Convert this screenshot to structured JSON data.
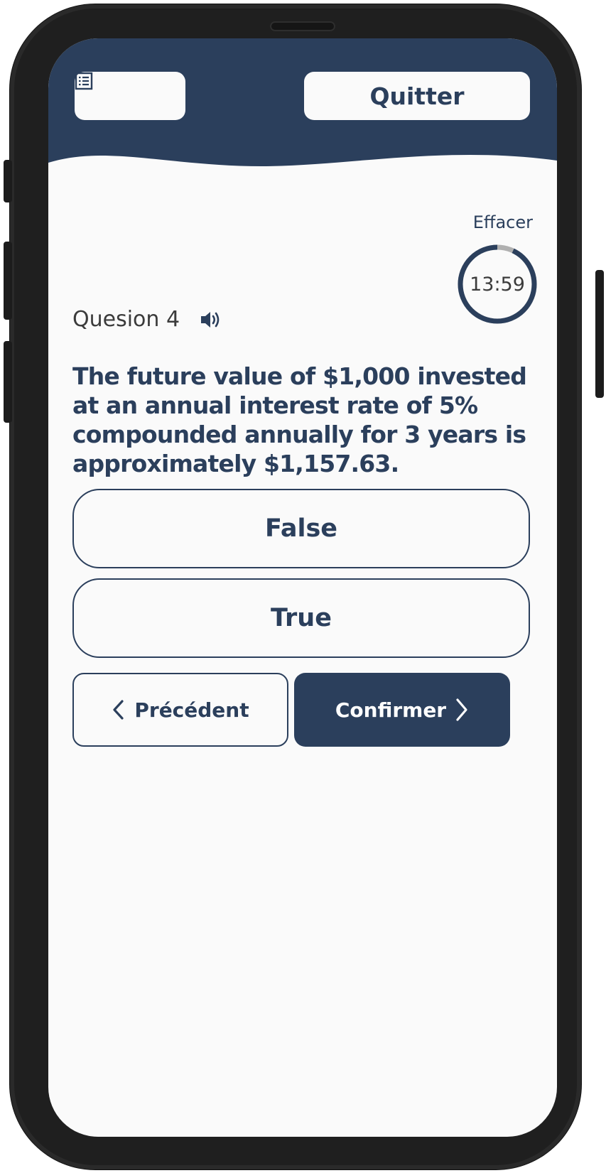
{
  "header": {
    "menu_icon": "list-icon",
    "quit_label": "Quitter"
  },
  "quiz": {
    "clear_label": "Effacer",
    "question_label": "Quesion 4",
    "audio_icon": "speaker-icon",
    "timer": {
      "text": "13:59",
      "remaining_fraction": 0.93
    },
    "question_text": "The future value of $1,000 invested at an annual interest rate of 5% compounded annually for 3 years is approximately $1,157.63.",
    "answers": [
      {
        "label": "False"
      },
      {
        "label": "True"
      }
    ]
  },
  "navigation": {
    "prev_label": "Précédent",
    "confirm_label": "Confirmer"
  },
  "colors": {
    "primary": "#2b3f5c",
    "background": "#fafafa",
    "timer_track": "#b0b0b0",
    "text_dark": "#3b3b3b"
  }
}
